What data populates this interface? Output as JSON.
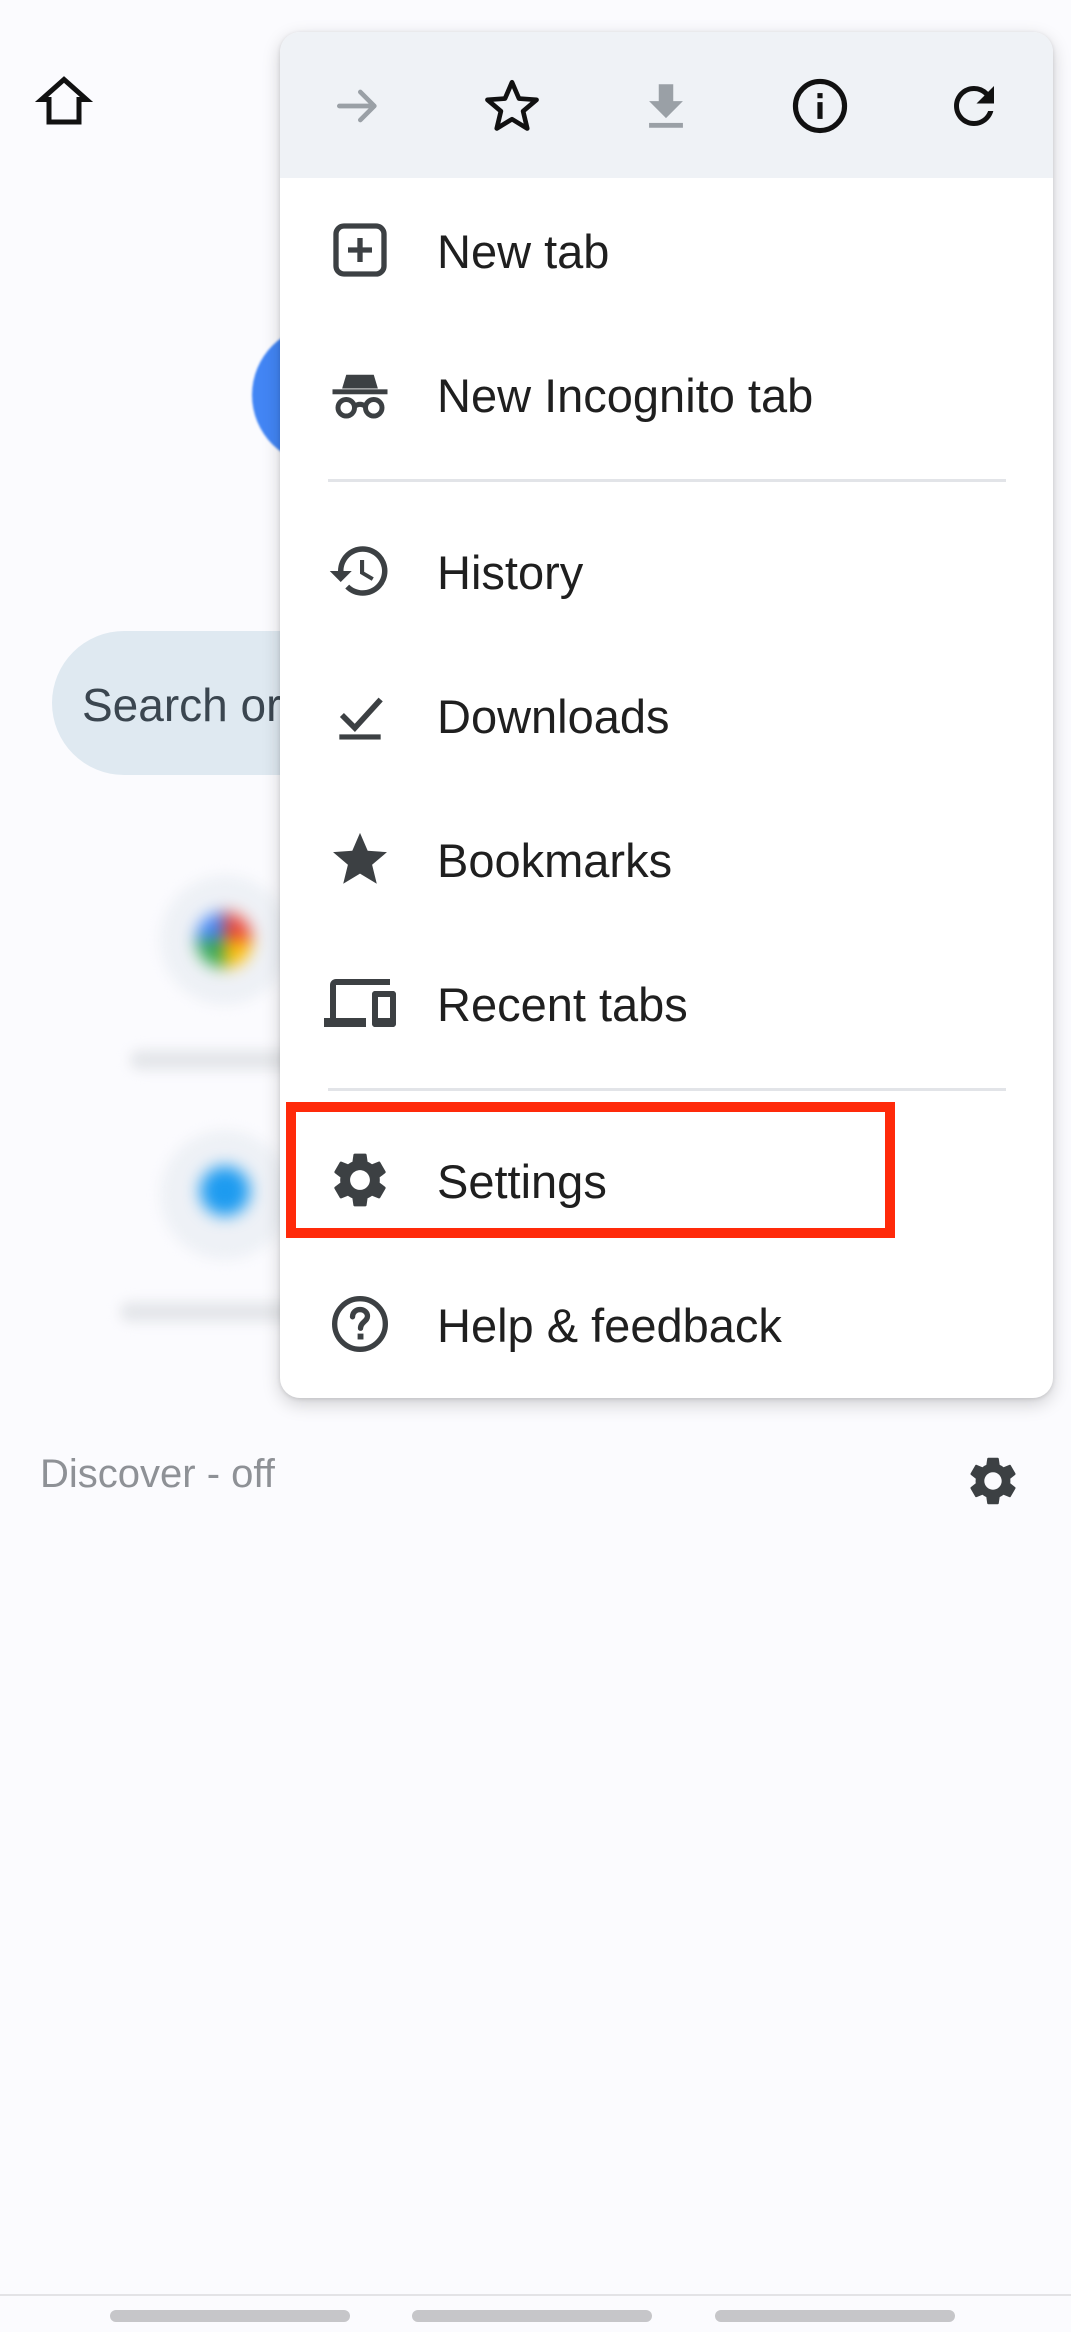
{
  "background": {
    "search_placeholder": "Search or",
    "discover_label": "Discover - off"
  },
  "menu": {
    "top_icons": [
      "forward-icon",
      "star-outline-icon",
      "download-icon",
      "info-icon",
      "refresh-icon"
    ],
    "items": [
      {
        "label": "New tab",
        "icon": "add-box-icon"
      },
      {
        "label": "New Incognito tab",
        "icon": "incognito-icon"
      },
      {
        "label": "History",
        "icon": "history-icon"
      },
      {
        "label": "Downloads",
        "icon": "download-done-icon"
      },
      {
        "label": "Bookmarks",
        "icon": "star-filled-icon"
      },
      {
        "label": "Recent tabs",
        "icon": "devices-icon"
      },
      {
        "label": "Settings",
        "icon": "gear-icon"
      },
      {
        "label": "Help & feedback",
        "icon": "help-icon"
      }
    ]
  },
  "colors": {
    "menu_header": "#eff2f6",
    "icon": "#3c4043",
    "highlight": "#ff2a0a",
    "search_pill": "#dfe9f1"
  }
}
